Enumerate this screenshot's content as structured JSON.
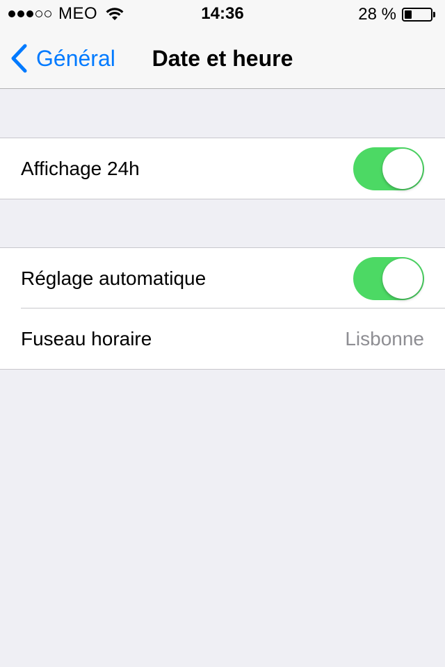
{
  "status_bar": {
    "signal_dots_filled": 3,
    "signal_dots_total": 5,
    "carrier": "MEO",
    "time": "14:36",
    "battery_percent_label": "28 %",
    "battery_level": 0.28
  },
  "nav": {
    "back_label": "Général",
    "title": "Date et heure"
  },
  "groups": [
    {
      "rows": [
        {
          "label": "Affichage 24h",
          "toggle": true
        }
      ]
    },
    {
      "rows": [
        {
          "label": "Réglage automatique",
          "toggle": true
        },
        {
          "label": "Fuseau horaire",
          "value": "Lisbonne"
        }
      ]
    }
  ],
  "colors": {
    "accent": "#007aff",
    "toggle_on": "#4cd964",
    "background": "#efeff4"
  },
  "icons": [
    "wifi-icon",
    "battery-icon",
    "chevron-left-icon",
    "signal-dots-icon"
  ]
}
